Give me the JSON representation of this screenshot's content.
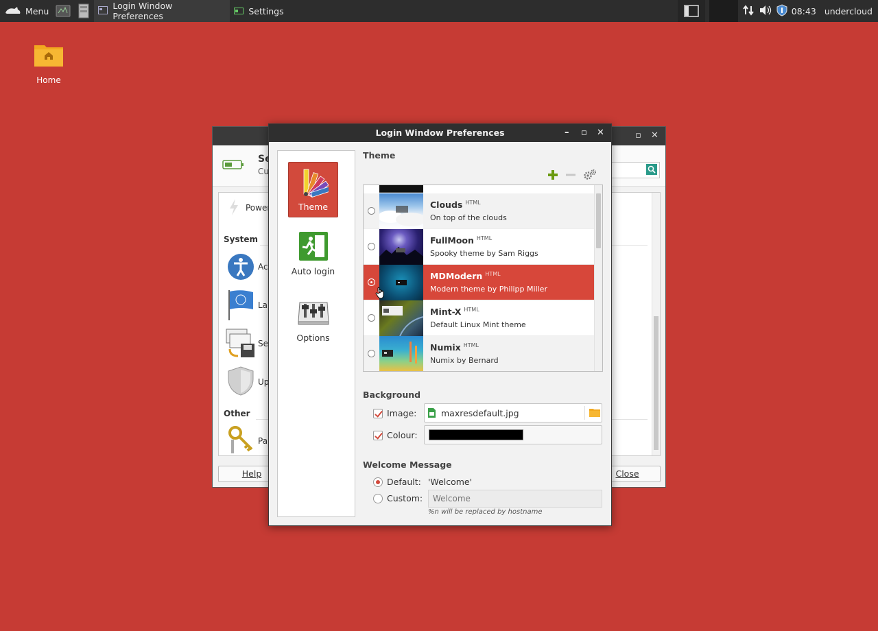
{
  "taskbar": {
    "menu_label": "Menu",
    "tasks": [
      {
        "label": "Login Window Preferences"
      },
      {
        "label": "Settings"
      }
    ],
    "clock": "08:43",
    "user": "undercloud"
  },
  "desktop": {
    "home_label": "Home"
  },
  "settings_window": {
    "title_initial": "Se",
    "subtitle_initial": "Cu",
    "items": {
      "power": "Power",
      "section_system": "System",
      "access": "Ac",
      "languages": "La",
      "sessions": "Se",
      "updates": "Up",
      "section_other": "Other",
      "passwords": "Pa"
    },
    "help_label": "Help",
    "close_label": "Close"
  },
  "dialog": {
    "title": "Login Window Preferences",
    "sidebar": [
      {
        "label": "Theme",
        "active": true
      },
      {
        "label": "Auto login",
        "active": false
      },
      {
        "label": "Options",
        "active": false
      }
    ],
    "theme_section": "Theme",
    "themes": [
      {
        "name": "Clouds",
        "tag": "HTML",
        "desc": "On top of the clouds",
        "selected": false
      },
      {
        "name": "FullMoon",
        "tag": "HTML",
        "desc": "Spooky theme by Sam Riggs",
        "selected": false
      },
      {
        "name": "MDModern",
        "tag": "HTML",
        "desc": "Modern theme by Philipp Miller",
        "selected": true
      },
      {
        "name": "Mint-X",
        "tag": "HTML",
        "desc": "Default Linux Mint theme",
        "selected": false
      },
      {
        "name": "Numix",
        "tag": "HTML",
        "desc": "Numix by Bernard",
        "selected": false
      }
    ],
    "background_section": "Background",
    "image_label": "Image:",
    "image_value": "maxresdefault.jpg",
    "colour_label": "Colour:",
    "colour_value": "#000000",
    "welcome_section": "Welcome Message",
    "default_label": "Default:",
    "default_value": "'Welcome'",
    "custom_label": "Custom:",
    "custom_placeholder": "Welcome",
    "hint": "%n will be replaced by hostname"
  },
  "colors": {
    "desktop": "#c63b34",
    "accent": "#d24a3c",
    "add_icon": "#6a9a10"
  }
}
